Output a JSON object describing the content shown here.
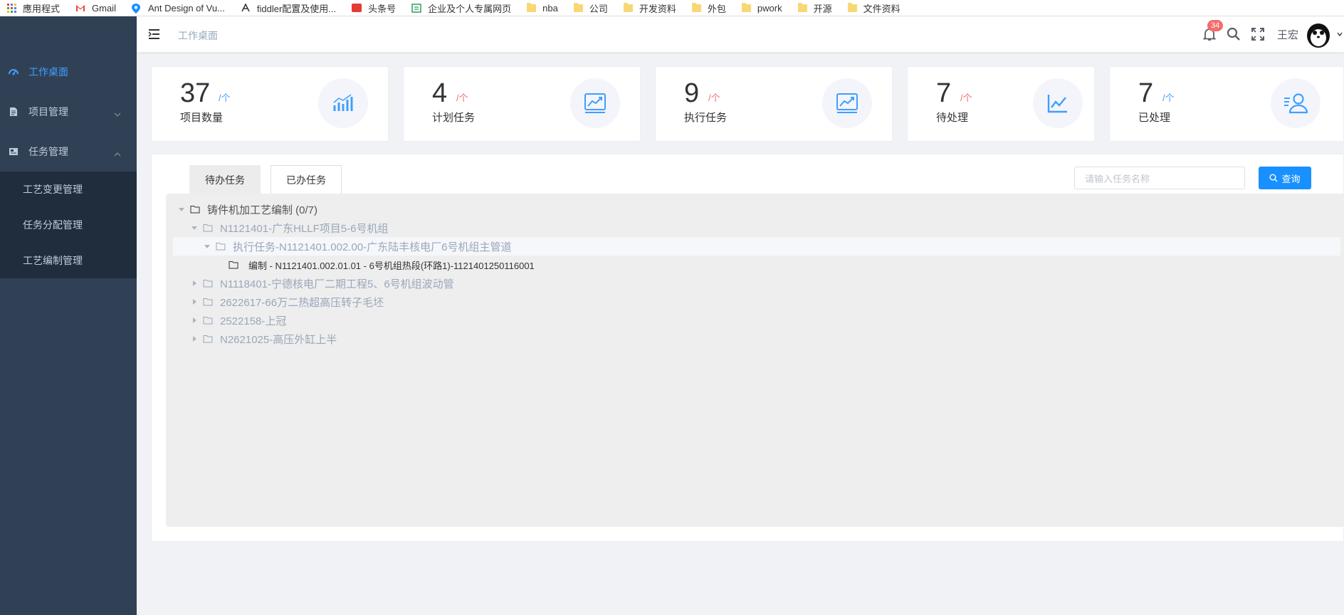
{
  "bookmarks": [
    {
      "label": "應用程式",
      "icon": "apps-icon"
    },
    {
      "label": "Gmail",
      "icon": "gmail-icon"
    },
    {
      "label": "Ant Design of Vu...",
      "icon": "ant-design-icon"
    },
    {
      "label": "fiddler配置及使用...",
      "icon": "fiddler-icon"
    },
    {
      "label": "头条号",
      "icon": "toutiao-icon"
    },
    {
      "label": "企业及个人专属网页",
      "icon": "enterprise-icon"
    },
    {
      "label": "nba",
      "icon": "folder-icon"
    },
    {
      "label": "公司",
      "icon": "folder-icon"
    },
    {
      "label": "开发资料",
      "icon": "folder-icon"
    },
    {
      "label": "外包",
      "icon": "folder-icon"
    },
    {
      "label": "pwork",
      "icon": "folder-icon"
    },
    {
      "label": "开源",
      "icon": "folder-icon"
    },
    {
      "label": "文件资料",
      "icon": "folder-icon"
    }
  ],
  "sidebar": {
    "items": [
      {
        "label": "工作桌面",
        "icon": "dashboard-icon",
        "active": true
      },
      {
        "label": "项目管理",
        "icon": "document-icon"
      },
      {
        "label": "任务管理",
        "icon": "task-icon"
      }
    ],
    "submenu": [
      "工艺变更管理",
      "任务分配管理",
      "工艺编制管理"
    ]
  },
  "navbar": {
    "breadcrumb": "工作桌面",
    "badge_count": "34",
    "username": "王宏"
  },
  "stats": [
    {
      "value": "37",
      "unit": "/个",
      "label": "项目数量",
      "unit_color": "#409eff",
      "icon": "bar-chart-icon"
    },
    {
      "value": "4",
      "unit": "/个",
      "label": "计划任务",
      "unit_color": "#f56c6c",
      "icon": "trend-chart-icon"
    },
    {
      "value": "9",
      "unit": "/个",
      "label": "执行任务",
      "unit_color": "#f56c6c",
      "icon": "trend-chart-icon"
    },
    {
      "value": "7",
      "unit": "/个",
      "label": "待处理",
      "unit_color": "#f56c6c",
      "icon": "line-chart-icon"
    },
    {
      "value": "7",
      "unit": "/个",
      "label": "已处理",
      "unit_color": "#409eff",
      "icon": "user-list-icon"
    }
  ],
  "tabs": [
    "待办任务",
    "已办任务"
  ],
  "search": {
    "placeholder": "请输入任务名称",
    "button": "查询"
  },
  "tree": [
    {
      "label": "铸件机加工艺编制 (0/7)",
      "level": 0,
      "expanded": true
    },
    {
      "label": "N1121401-广东HLLF项目5-6号机组",
      "level": 1,
      "expanded": true
    },
    {
      "label": "执行任务-N1121401.002.00-广东陆丰核电厂6号机组主管道",
      "level": 2,
      "expanded": true
    },
    {
      "label": "编制 - N1121401.002.01.01 - 6号机组热段(环路1)-1121401250116001",
      "level": 3,
      "leaf": true
    },
    {
      "label": "N1118401-宁德核电厂二期工程5、6号机组波动管",
      "level": 1,
      "expanded": false
    },
    {
      "label": "2622617-66万二热超高压转子毛坯",
      "level": 1,
      "expanded": false
    },
    {
      "label": "2522158-上冠",
      "level": 1,
      "expanded": false
    },
    {
      "label": "N2621025-高压外缸上半",
      "level": 1,
      "expanded": false
    }
  ],
  "colors": {
    "accent": "#1890ff",
    "sidebar": "#304156",
    "submenu": "#1f2d3d",
    "active": "#409eff"
  }
}
